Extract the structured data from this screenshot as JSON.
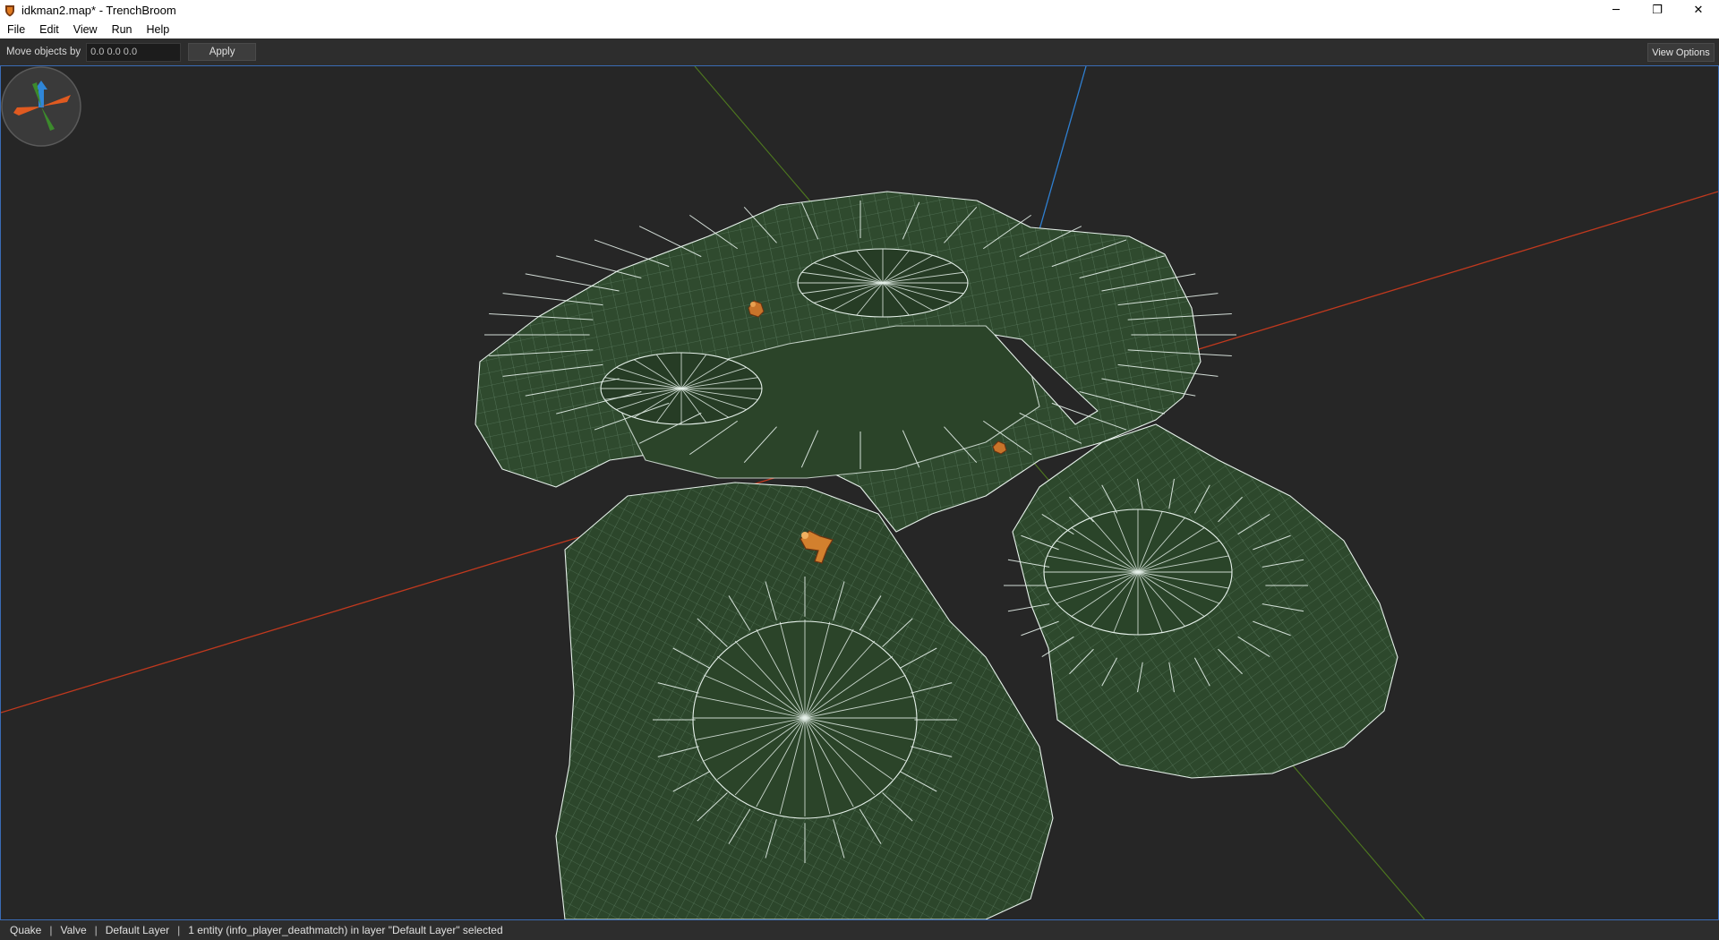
{
  "window": {
    "title": "idkman2.map* - TrenchBroom",
    "icon": "trenchbroom-shield-icon",
    "controls": {
      "minimize": "─",
      "restore": "❐",
      "close": "✕"
    }
  },
  "menu": {
    "items": [
      "File",
      "Edit",
      "View",
      "Run",
      "Help"
    ]
  },
  "toolbar": {
    "move_label": "Move objects by",
    "move_value": "0.0 0.0 0.0",
    "apply_label": "Apply",
    "view_options_label": "View Options"
  },
  "viewport": {
    "background": "#262626",
    "axis_x_color": "#c0391e",
    "axis_y_color": "#4f7a1f",
    "axis_z_color": "#2f7fd0",
    "brush_fill": "#2f4a2e",
    "grid_line_color": "#9fc6ae",
    "entities": [
      "info_player_deathmatch",
      "info_player_deathmatch",
      "info_player_deathmatch"
    ]
  },
  "statusbar": {
    "game": "Quake",
    "format": "Valve",
    "layer": "Default Layer",
    "selection": "1 entity (info_player_deathmatch) in layer \"Default Layer\" selected"
  }
}
